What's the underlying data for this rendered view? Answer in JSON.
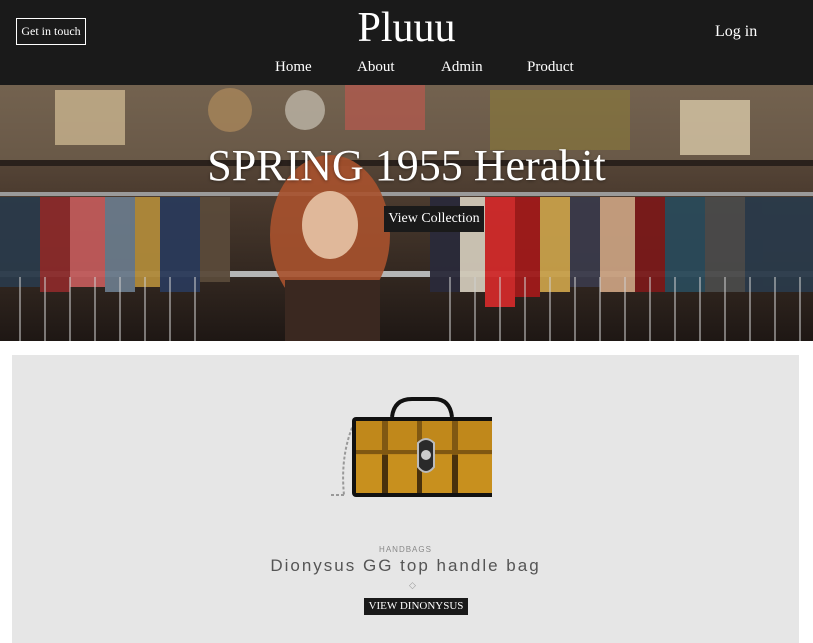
{
  "header": {
    "contact_label": "Get in touch",
    "logo": "Pluuu",
    "login_label": "Log in",
    "nav": {
      "home": "Home",
      "about": "About",
      "admin": "Admin",
      "product": "Product"
    }
  },
  "hero": {
    "title": "SPRING 1955 Herabit",
    "button_label": "View Collection"
  },
  "product": {
    "category": "HANDBAGS",
    "name": "Dionysus GG top handle bag",
    "divider_icon": "◇",
    "button_label": "VIEW DINONYSUS"
  },
  "colors": {
    "header_bg": "#1a1a1a",
    "card_bg": "#e6e6e6",
    "button_bg": "#1a1a1a",
    "bag_yellow": "#c8901e"
  }
}
